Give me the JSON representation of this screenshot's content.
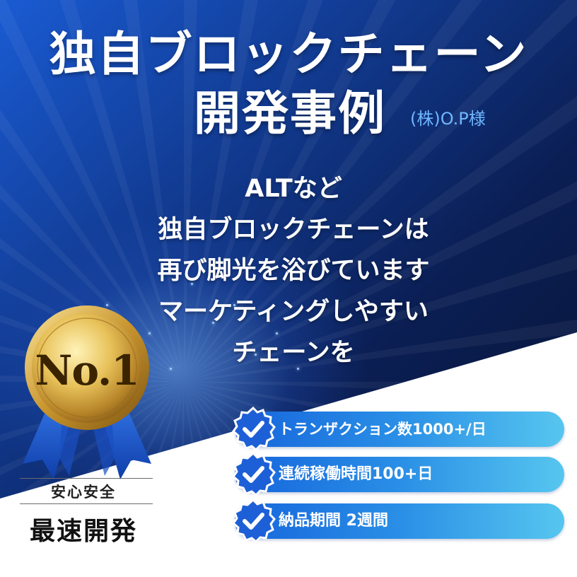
{
  "headline": {
    "line1": "独自ブロックチェーン",
    "line2": "開発事例",
    "client": "(株)O.P様"
  },
  "message": {
    "lines": [
      "ALTなど",
      "独自ブロックチェーンは",
      "再び脚光を浴びています",
      "マーケティングしやすい",
      "チェーンを"
    ]
  },
  "award": {
    "medal_text": "No.1",
    "subtitle": "安心安全",
    "title": "最速開発"
  },
  "features": [
    {
      "label": "トランザクション数1000+/日",
      "icon": "check-badge-icon"
    },
    {
      "label": "連続稼働時間100+日",
      "icon": "check-badge-icon"
    },
    {
      "label": "納品期間 2週間",
      "icon": "check-badge-icon"
    }
  ],
  "colors": {
    "dark_bg": "#07122f",
    "accent_blue": "#1665dc",
    "accent_light": "#56c6ef",
    "client_text": "#6fb6ff",
    "gold": "#d9a93b"
  }
}
